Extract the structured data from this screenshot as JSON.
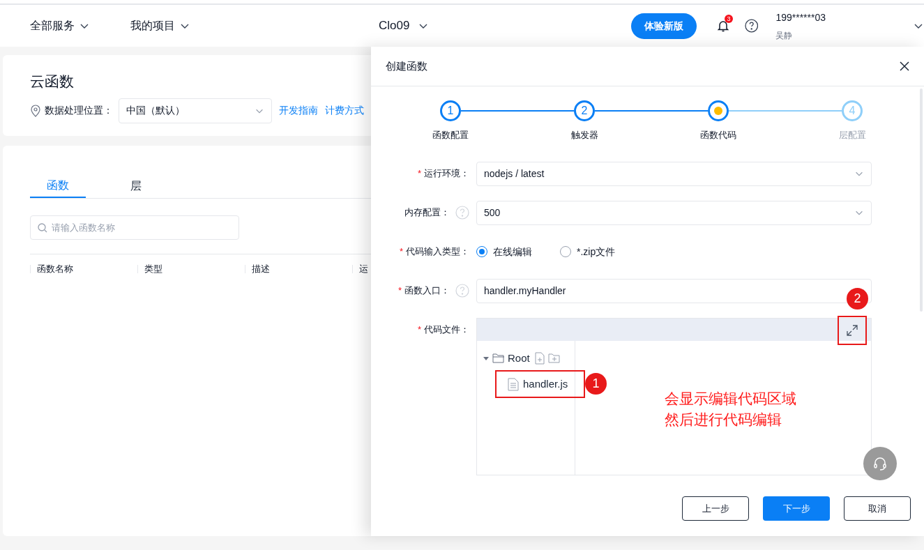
{
  "header": {
    "nav": [
      {
        "label": "全部服务"
      },
      {
        "label": "我的项目"
      }
    ],
    "project": "Clo09",
    "try_button": "体验新版",
    "notification_count": "3",
    "user": {
      "phone": "199******03",
      "name": "吴静"
    }
  },
  "page": {
    "title": "云函数",
    "location_label": "数据处理位置：",
    "location_value": "中国（默认）",
    "links": [
      "开发指南",
      "计费方式"
    ]
  },
  "tabs": [
    {
      "label": "函数",
      "selected": true
    },
    {
      "label": "层",
      "selected": false
    }
  ],
  "search": {
    "placeholder": "请输入函数名称"
  },
  "table": {
    "columns": [
      "函数名称",
      "类型",
      "描述",
      "运"
    ]
  },
  "drawer": {
    "title": "创建函数",
    "steps": [
      {
        "number": "1",
        "label": "函数配置",
        "kind": "done"
      },
      {
        "number": "2",
        "label": "触发器",
        "kind": "done"
      },
      {
        "label": "函数代码",
        "kind": "current"
      },
      {
        "number": "4",
        "label": "层配置",
        "kind": "pending"
      }
    ],
    "form": [
      {
        "kind": "select",
        "required_mark": "*",
        "label": "运行环境：",
        "help": false,
        "value": "nodejs / latest"
      },
      {
        "kind": "select",
        "label": "内存配置：",
        "help": true,
        "value": "500"
      },
      {
        "kind": "radio",
        "required_mark": "*",
        "label": "代码输入类型：",
        "help": false,
        "options": [
          {
            "label": "在线编辑",
            "selected": true
          },
          {
            "label": "*.zip文件",
            "selected": false
          }
        ]
      },
      {
        "kind": "input",
        "required_mark": "*",
        "label": "函数入口：",
        "help": true,
        "value": "handler.myHandler"
      },
      {
        "kind": "code",
        "required_mark": "*",
        "label": "代码文件：",
        "help": false,
        "tree": {
          "label": "Root",
          "expanded": true,
          "children": [
            {
              "label": "handler.js"
            }
          ]
        }
      }
    ],
    "buttons": [
      {
        "label": "上一步",
        "primary": false
      },
      {
        "label": "下一步",
        "primary": true
      },
      {
        "label": "取消",
        "primary": false
      }
    ]
  },
  "annotations": {
    "file_marker": "1",
    "expand_marker": "2",
    "note": [
      "会显示编辑代码区域",
      "然后进行代码编辑"
    ]
  }
}
